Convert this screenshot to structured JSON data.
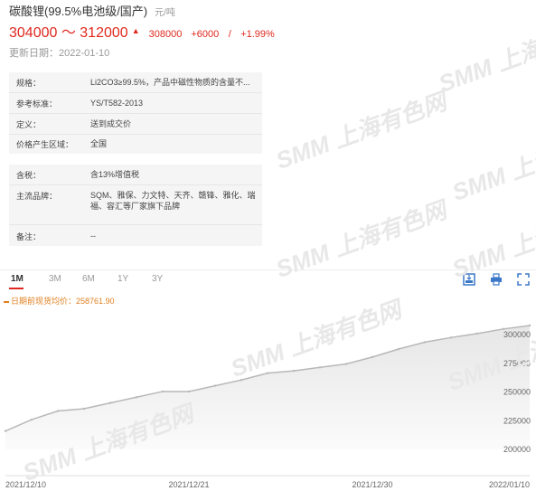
{
  "header": {
    "title": "碳酸锂(99.5%电池级/国产)",
    "unit": "元/吨",
    "price_range": "304000 ～ 312000",
    "up_arrow": "▲",
    "avg_price": "308000",
    "change": "+6000",
    "change_sep": "/",
    "change_pct": "+1.99%",
    "updated": "更新日期：2022-01-10"
  },
  "specs_a": [
    {
      "key": "规格：",
      "value": "Li2CO3≥99.5%，产品中磁性物质的含量不..."
    },
    {
      "key": "参考标准：",
      "value": "YS/T582-2013"
    },
    {
      "key": "定义：",
      "value": "送到成交价"
    },
    {
      "key": "价格产生区域：",
      "value": "全国"
    }
  ],
  "specs_b": [
    {
      "key": "含税：",
      "value": "含13%增值税"
    },
    {
      "key": "主流品牌：",
      "value": "SQM、雅保、力文特、天齐、赣锋、雅化、瑞福、容汇等厂家旗下品牌"
    },
    {
      "key": "备注：",
      "value": "--"
    }
  ],
  "tabs": [
    "1M",
    "3M",
    "6M",
    "1Y",
    "3Y"
  ],
  "active_tab": "1M",
  "tools": [
    "image-download-icon",
    "print-icon",
    "fullscreen-icon"
  ],
  "watermark": "SMM 上海有色网",
  "accent_color": "#e0281e",
  "line_color": "#b8b8b8",
  "chart_data": {
    "type": "area",
    "legend": "日期前现货均价：258761.90",
    "x": [
      "2021/12/10",
      "2021/12/13",
      "2021/12/14",
      "2021/12/15",
      "2021/12/16",
      "2021/12/17",
      "2021/12/20",
      "2021/12/21",
      "2021/12/22",
      "2021/12/23",
      "2021/12/24",
      "2021/12/27",
      "2021/12/28",
      "2021/12/29",
      "2021/12/30",
      "2021/12/31",
      "2022/01/04",
      "2022/01/05",
      "2022/01/06",
      "2022/01/07",
      "2022/01/10"
    ],
    "values": [
      216000,
      226000,
      233500,
      235500,
      240500,
      245500,
      250500,
      250500,
      255500,
      260500,
      266500,
      268500,
      271500,
      274500,
      280500,
      287500,
      293500,
      297500,
      301000,
      305000,
      308000
    ],
    "x_ticks": [
      "2021/12/10",
      "2021/12/21",
      "2021/12/30",
      "2022/01/10"
    ],
    "y_ticks": [
      200000,
      225000,
      250000,
      275000,
      300000
    ],
    "ylim": [
      200000,
      308000
    ],
    "grid": false
  }
}
